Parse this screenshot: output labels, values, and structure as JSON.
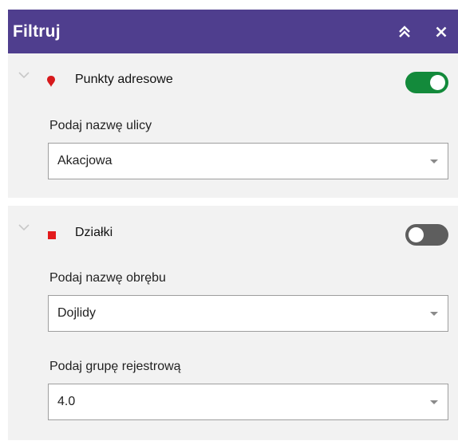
{
  "header": {
    "title": "Filtruj",
    "background": "#4f3e8e",
    "collapse_icon": "double-chevron-up-icon",
    "close_icon": "close-icon"
  },
  "layers": [
    {
      "name": "Punkty adresowe",
      "icon": "red-pin-icon",
      "icon_color": "#d7191c",
      "enabled": true,
      "fields": [
        {
          "label": "Podaj nazwę ulicy",
          "value": "Akacjowa"
        }
      ]
    },
    {
      "name": "Działki",
      "icon": "red-square-icon",
      "icon_color": "#e31a1c",
      "enabled": false,
      "fields": [
        {
          "label": "Podaj nazwę obrębu",
          "value": "Dojlidy"
        },
        {
          "label": "Podaj grupę rejestrową",
          "value": "4.0"
        }
      ]
    }
  ],
  "colors": {
    "toggle_on": "#138a3b",
    "toggle_off": "#5e5e5e",
    "section_bg": "#f2f2f2"
  }
}
